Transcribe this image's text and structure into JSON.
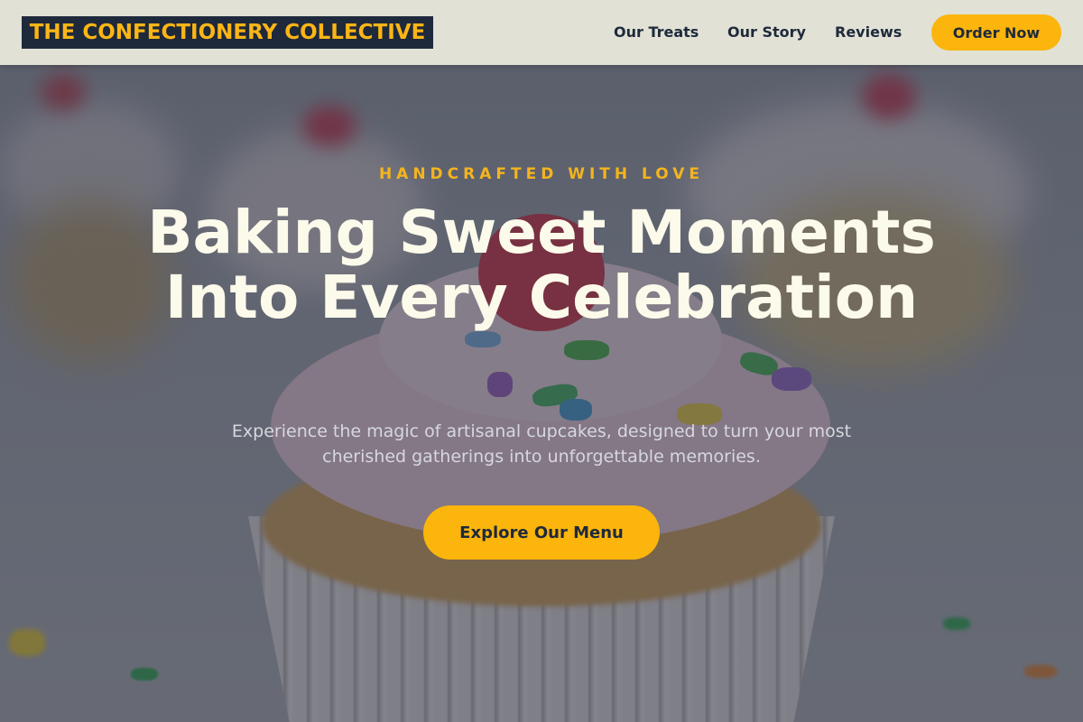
{
  "header": {
    "logo_text": "THE CONFECTIONERY COLLECTIVE",
    "nav": [
      {
        "label": "Our Treats"
      },
      {
        "label": "Our Story"
      },
      {
        "label": "Reviews"
      }
    ],
    "cta_label": "Order Now"
  },
  "hero": {
    "kicker": "HANDCRAFTED WITH LOVE",
    "headline": "Baking Sweet Moments Into Every Celebration",
    "subtitle": "Experience the magic of artisanal cupcakes, designed to turn your most cherished gatherings into unforgettable memories.",
    "cta_label": "Explore Our Menu",
    "background_image": "cupcake-photo"
  },
  "colors": {
    "brand_dark": "#1e293b",
    "accent_gold": "#fbb50c",
    "header_bg": "#e1e1d5",
    "headline": "#fcfaea"
  }
}
